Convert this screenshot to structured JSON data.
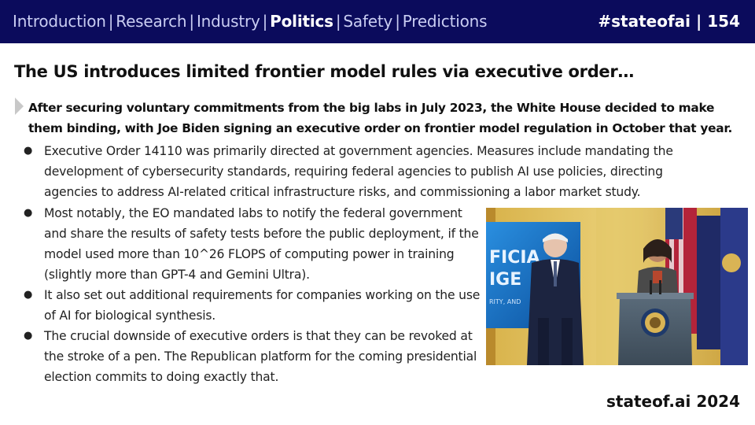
{
  "header": {
    "nav": [
      "Introduction",
      "Research",
      "Industry",
      "Politics",
      "Safety",
      "Predictions"
    ],
    "separator": "|",
    "active_index": 3,
    "tag": "#stateofai | 154"
  },
  "slide": {
    "title": "The US introduces limited frontier model rules via executive order…",
    "intro": "After securing voluntary commitments from the big labs in July 2023, the White House decided to make them binding, with Joe Biden signing an executive order on frontier model regulation in October that year.",
    "bullets": [
      "Executive Order 14110 was primarily directed at government agencies. Measures include mandating the development of cybersecurity standards, requiring federal agencies to publish AI use policies, directing agencies to address AI-related critical infrastructure risks, and commissioning a labor market study.",
      "Most notably, the EO mandated labs to notify the federal government and share the results of safety tests before the public deployment, if the model used more than 10^26 FLOPS of computing power in training (slightly more than GPT-4 and Gemini Ultra).",
      "It also set out additional requirements for companies working on the use of AI for biological synthesis.",
      "The crucial downside of executive orders is that they can be revoked at the stroke of a pen. The Republican platform for the coming presidential election commits to doing exactly that."
    ],
    "bullet_marker": "●",
    "photo": {
      "screen_text_1": "FICIA",
      "screen_text_2": "IGE",
      "screen_text_3": "RITY, AND"
    }
  },
  "footer": {
    "brand": "stateof.ai 2024"
  },
  "colors": {
    "header_bg": "#0b0b5c",
    "nav_inactive": "#c9cdf2",
    "nav_active": "#ffffff"
  }
}
